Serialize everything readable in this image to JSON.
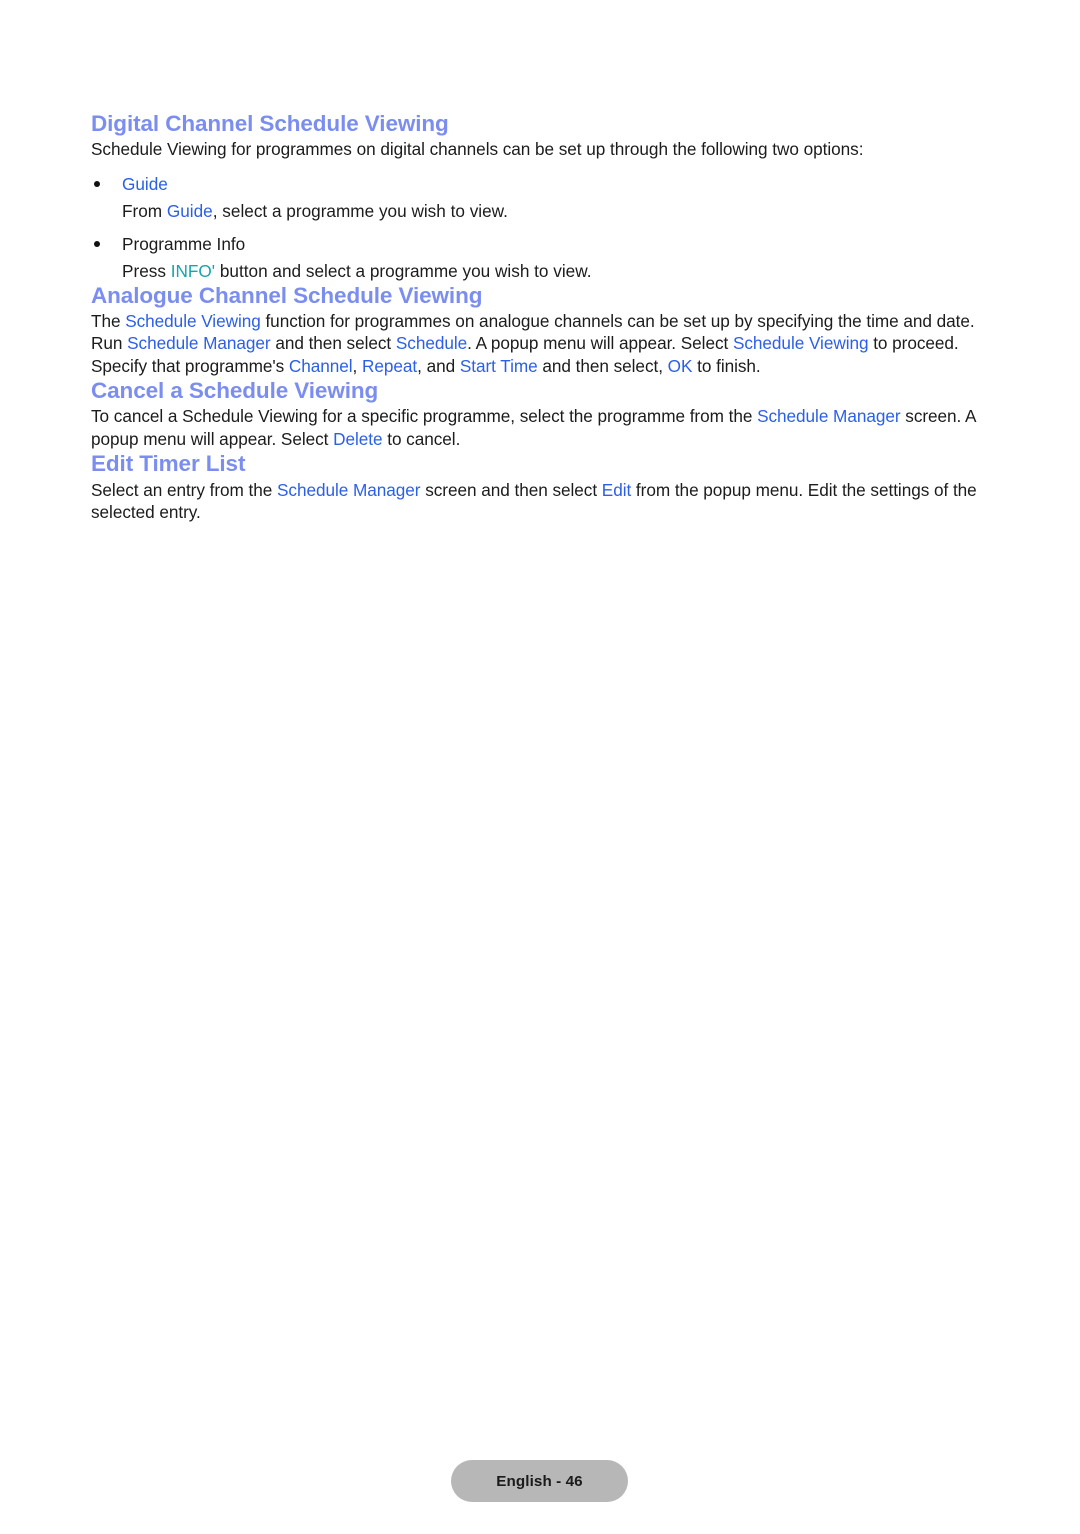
{
  "page": {
    "background_color": "#ffffff",
    "heading_color": "#7b8ef0",
    "link_color": "#2b5fe8",
    "accent_teal_color": "#17a5a8",
    "body_text_color": "#1c1c1c"
  },
  "sections": {
    "digital": {
      "heading": "Digital Channel Schedule Viewing",
      "intro": "Schedule Viewing for programmes on digital channels can be set up through the following two options:",
      "bullets": [
        {
          "title": "Guide",
          "title_is_link": true,
          "desc_before": "From ",
          "desc_link": "Guide",
          "desc_after": ", select a programme you wish to view."
        },
        {
          "title": "Programme Info",
          "title_is_link": false,
          "desc_before": "Press ",
          "desc_link": "INFO'",
          "desc_after": " button and select a programme you wish to view."
        }
      ]
    },
    "analogue": {
      "heading": "Analogue Channel Schedule Viewing",
      "line1_a": "The ",
      "line1_link1": "Schedule Viewing",
      "line1_b": " function for programmes on analogue channels can be set up by specifying the time and date.",
      "line2_a": "Run ",
      "line2_link1": "Schedule Manager",
      "line2_b": " and then select ",
      "line2_link2": "Schedule",
      "line2_c": ". A popup menu will appear. Select ",
      "line2_link3": "Schedule Viewing",
      "line2_d": " to proceed.",
      "line3_a": "Specify that programme's ",
      "line3_link1": "Channel",
      "line3_b": ", ",
      "line3_link2": "Repeat",
      "line3_c": ", and ",
      "line3_link3": "Start Time",
      "line3_d": " and then select, ",
      "line3_link4": "OK",
      "line3_e": " to finish."
    },
    "cancel": {
      "heading": "Cancel a Schedule Viewing",
      "body_a": "To cancel a Schedule Viewing for a specific programme, select the programme from the ",
      "body_link1": "Schedule Manager",
      "body_b": " screen. A popup menu will appear. Select ",
      "body_link2": "Delete",
      "body_c": " to cancel."
    },
    "edit_timer": {
      "heading": "Edit Timer List",
      "body_a": "Select an entry from the ",
      "body_link1": "Schedule Manager",
      "body_b": " screen and then select ",
      "body_link2": "Edit",
      "body_c": " from the popup menu. Edit the settings of the selected entry."
    }
  },
  "footer": {
    "label": "English - 46"
  }
}
